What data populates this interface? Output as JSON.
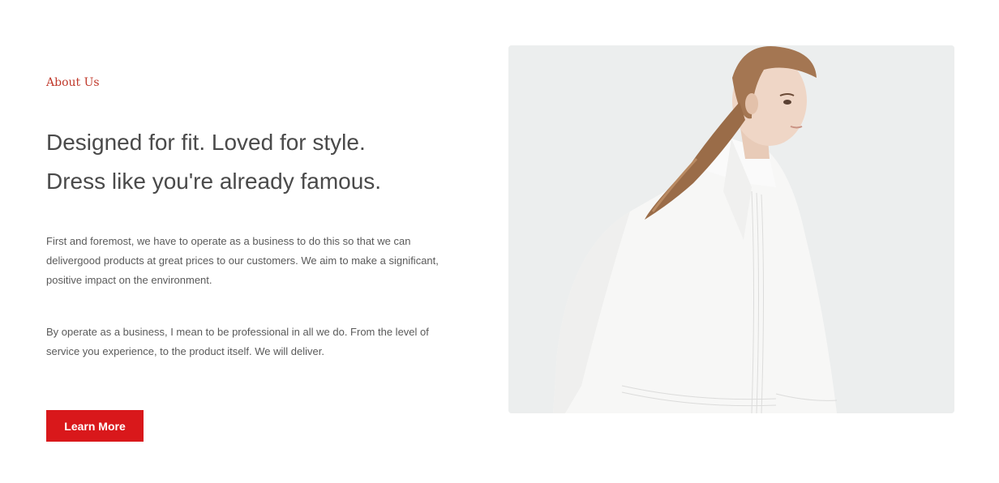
{
  "about": {
    "eyebrow": "About Us",
    "headline_line1": "Designed for fit. Loved for style.",
    "headline_line2": "Dress like you're already famous.",
    "paragraph1": "First and foremost, we have to operate as a business to do this so that we can delivergood products at great prices to our customers. We aim to make a significant, positive impact on the environment.",
    "paragraph2": "By operate as a business, I mean to be professional in all we do. From the level of service you experience, to the product itself. We will deliver.",
    "button_label": "Learn More"
  },
  "colors": {
    "accent": "#d9181b",
    "eyebrow": "#c0392b",
    "heading": "#4a4a4a",
    "body_text": "#5a5a5a",
    "photo_background": "#eceeee"
  },
  "image": {
    "subject": "model-in-white-shirt-photo"
  }
}
